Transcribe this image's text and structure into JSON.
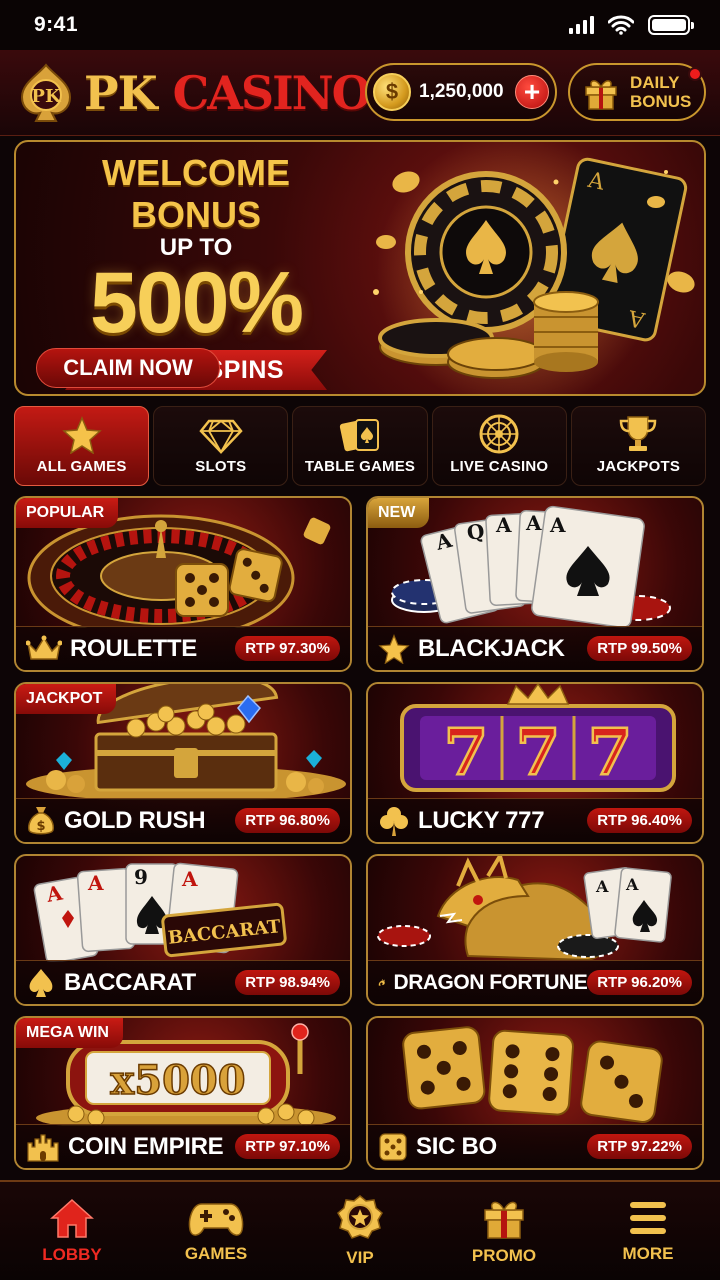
{
  "status_bar": {
    "time": "9:41"
  },
  "header": {
    "brand_pk": "PK",
    "brand_casino": "CASINO",
    "balance": "1,250,000",
    "daily_bonus_line1": "DAILY",
    "daily_bonus_line2": "BONUS"
  },
  "banner": {
    "title": "WELCOME BONUS",
    "up_to": "UP TO",
    "percent": "500%",
    "ribbon": "+ FREE SPINS",
    "cta": "CLAIM NOW"
  },
  "categories": [
    {
      "label": "ALL GAMES",
      "icon": "star-icon",
      "active": true
    },
    {
      "label": "SLOTS",
      "icon": "diamond-icon",
      "active": false
    },
    {
      "label": "TABLE GAMES",
      "icon": "cards-icon",
      "active": false
    },
    {
      "label": "LIVE CASINO",
      "icon": "roulette-wheel-icon",
      "active": false
    },
    {
      "label": "JACKPOTS",
      "icon": "trophy-icon",
      "active": false
    }
  ],
  "games": [
    {
      "name": "ROULETTE",
      "rtp": "RTP 97.30%",
      "tag": "POPULAR",
      "icon": "crown-icon"
    },
    {
      "name": "BLACKJACK",
      "rtp": "RTP 99.50%",
      "tag": "NEW",
      "icon": "star-icon"
    },
    {
      "name": "GOLD RUSH",
      "rtp": "RTP 96.80%",
      "tag": "JACKPOT",
      "icon": "money-bag-icon"
    },
    {
      "name": "LUCKY 777",
      "rtp": "RTP 96.40%",
      "tag": "",
      "icon": "clover-icon"
    },
    {
      "name": "BACCARAT",
      "rtp": "RTP 98.94%",
      "tag": "",
      "icon": "spade-icon"
    },
    {
      "name": "DRAGON FORTUNE",
      "rtp": "RTP 96.20%",
      "tag": "",
      "icon": "dragon-icon"
    },
    {
      "name": "COIN EMPIRE",
      "rtp": "RTP 97.10%",
      "tag": "MEGA WIN",
      "icon": "castle-icon"
    },
    {
      "name": "SIC BO",
      "rtp": "RTP 97.22%",
      "tag": "",
      "icon": "dice-icon"
    }
  ],
  "art_text": {
    "baccarat_sign": "BACCARAT",
    "mega_multiplier": "x5000",
    "sevens": "777"
  },
  "nav": [
    {
      "label": "LOBBY",
      "icon": "home-icon",
      "active": true
    },
    {
      "label": "GAMES",
      "icon": "gamepad-icon",
      "active": false
    },
    {
      "label": "VIP",
      "icon": "vip-badge-icon",
      "active": false
    },
    {
      "label": "PROMO",
      "icon": "gift-icon",
      "active": false
    },
    {
      "label": "MORE",
      "icon": "menu-icon",
      "active": false
    }
  ],
  "colors": {
    "gold": "#f2c14e",
    "red": "#c31a14",
    "background": "#0d0506"
  }
}
